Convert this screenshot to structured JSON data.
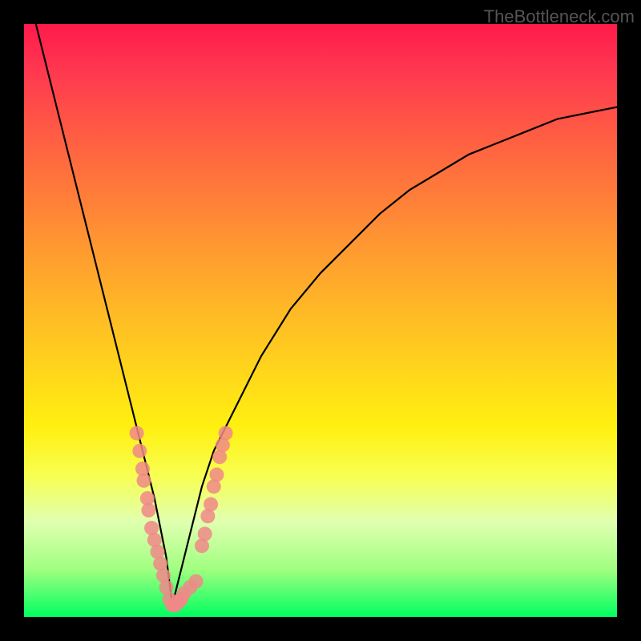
{
  "watermark": "TheBottleneck.com",
  "chart_data": {
    "type": "line",
    "title": "",
    "xlabel": "",
    "ylabel": "",
    "xlim": [
      0,
      100
    ],
    "ylim": [
      0,
      100
    ],
    "series": [
      {
        "name": "bottleneck-curve",
        "description": "V-shaped curve representing bottleneck percentage; minimum near x≈25",
        "x": [
          2,
          4,
          6,
          8,
          10,
          12,
          14,
          16,
          18,
          20,
          22,
          24,
          25,
          26,
          28,
          30,
          32,
          35,
          40,
          45,
          50,
          55,
          60,
          65,
          70,
          75,
          80,
          85,
          90,
          95,
          100
        ],
        "y": [
          100,
          92,
          84,
          76,
          68,
          60,
          52,
          44,
          36,
          28,
          20,
          10,
          2,
          6,
          14,
          22,
          28,
          34,
          44,
          52,
          58,
          63,
          68,
          72,
          75,
          78,
          80,
          82,
          84,
          85,
          86
        ]
      }
    ],
    "highlighted_points": {
      "name": "pink-markers",
      "description": "Salmon/pink data markers clustered near bottom of V",
      "points": [
        {
          "x": 19,
          "y": 31
        },
        {
          "x": 19.5,
          "y": 28
        },
        {
          "x": 20,
          "y": 25
        },
        {
          "x": 20.2,
          "y": 23
        },
        {
          "x": 20.8,
          "y": 20
        },
        {
          "x": 21,
          "y": 18
        },
        {
          "x": 21.5,
          "y": 15
        },
        {
          "x": 22,
          "y": 13
        },
        {
          "x": 22.5,
          "y": 11
        },
        {
          "x": 23,
          "y": 9
        },
        {
          "x": 23.5,
          "y": 7
        },
        {
          "x": 24,
          "y": 5
        },
        {
          "x": 24.5,
          "y": 3
        },
        {
          "x": 25,
          "y": 2
        },
        {
          "x": 25.5,
          "y": 2
        },
        {
          "x": 26,
          "y": 2.5
        },
        {
          "x": 26.5,
          "y": 3
        },
        {
          "x": 27,
          "y": 4
        },
        {
          "x": 28,
          "y": 5
        },
        {
          "x": 29,
          "y": 6
        },
        {
          "x": 30,
          "y": 12
        },
        {
          "x": 30.5,
          "y": 14
        },
        {
          "x": 31,
          "y": 17
        },
        {
          "x": 31.5,
          "y": 19
        },
        {
          "x": 32,
          "y": 22
        },
        {
          "x": 32.5,
          "y": 24
        },
        {
          "x": 33,
          "y": 27
        },
        {
          "x": 33.5,
          "y": 29
        },
        {
          "x": 34,
          "y": 31
        }
      ]
    },
    "gradient_meaning": "Background gradient from red (100%, bad/high bottleneck) at top to green (0%, good/no bottleneck) at bottom"
  }
}
